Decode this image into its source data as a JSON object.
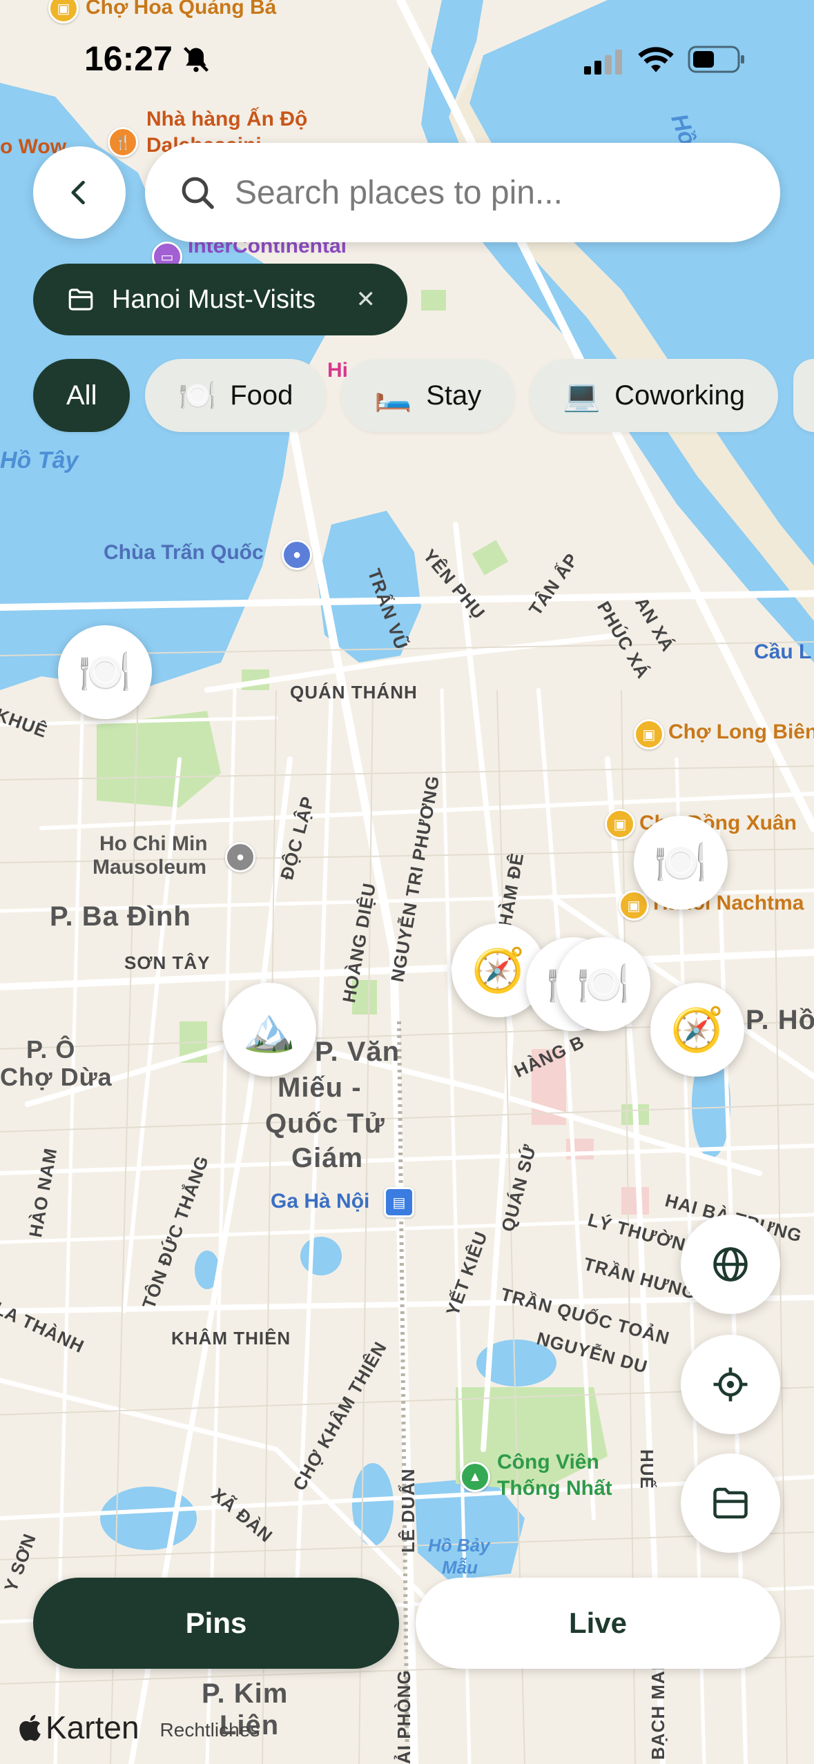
{
  "status_bar": {
    "time": "16:27",
    "icons": [
      "bell-slash-icon",
      "cellular-signal-icon",
      "wifi-icon",
      "battery-icon"
    ]
  },
  "header": {
    "back_icon": "chevron-left-icon",
    "search": {
      "placeholder": "Search places to pin...",
      "value": "",
      "icon": "search-icon"
    }
  },
  "collection": {
    "label": "Hanoi Must-Visits",
    "icon": "folder-icon",
    "close_icon": "close-icon"
  },
  "filters": [
    {
      "label": "All",
      "emoji": "",
      "active": true
    },
    {
      "label": "Food",
      "emoji": "🍽️",
      "active": false
    },
    {
      "label": "Stay",
      "emoji": "🛏️",
      "active": false
    },
    {
      "label": "Coworking",
      "emoji": "💻",
      "active": false
    }
  ],
  "map_labels": {
    "cho_hoa": "Chợ Hoa Quảng Bá",
    "nha_hang": "Nhà hàng Ấn Độ",
    "nha_hang2": "Dalchessini",
    "wow": "o Wow",
    "intercontinental": "InterContinental",
    "ho_tay": "Hồ Tây",
    "hi": "Hi",
    "hong": "Hồng",
    "chua_tran_quoc": "Chùa Trấn Quốc",
    "yen_phu": "YÊN PHỤ",
    "tan_ap": "TÂN ẤP",
    "tran_vu": "TRẤN VŨ",
    "phuc_xa": "PHÚC XÁ",
    "an_xa": "AN XÁ",
    "cau_l": "Cầu L",
    "khue": "KHUÊ",
    "quan_thanh": "QUÁN THÁNH",
    "cho_long_bien": "Chợ Long Biên",
    "cho_dong_xuan": "Chợ Đồng Xuân",
    "nachtma": "Hanoi Nachtma",
    "hcm_mausoleum_1": "Ho Chi Min",
    "hcm_mausoleum_2": "Mausoleum",
    "doc_lap": "ĐỘC LẬP",
    "nguyen_tri_phuong": "NGUYỄN TRI PHƯƠNG",
    "hoang_dieu": "HOÀNG DIỆU",
    "ham_de": "HÀM ĐÊ",
    "ba_dinh": "P. Ba Đình",
    "son_tay": "SƠN TÂY",
    "p_ho": "P. Hồ",
    "p_o_cho_dua_1": "P. Ô",
    "p_o_cho_dua_2": "Chợ Dừa",
    "van_mieu_1": "P. Văn",
    "van_mieu_2": "Miếu -",
    "van_mieu_3": "Quốc Tử",
    "van_mieu_4": "Giám",
    "hang_bong": "HÀNG B",
    "hao_nam": "HÀO NAM",
    "ton_duc_thang": "TÔN ĐỨC THẮNG",
    "ga_ha_noi": "Ga Hà Nội",
    "quan_su": "QUÁN SỨ",
    "hai_ba_trung": "HAI BÀ TRƯNG",
    "ly_thuong": "LÝ THƯỜNG",
    "la_thanh": "LA THÀNH",
    "yet_kieu": "YẾT KIÊU",
    "tran_hung_dao": "TRẦN HƯNG Đ",
    "tran_quoc_toan": "TRẦN QUỐC TOẢN",
    "nguyen_du": "NGUYỄN DU",
    "kham_thien": "KHÂM THIÊN",
    "cho_kham_thien": "CHỢ KHÂM THIÊN",
    "cong_vien_1": "Công Viên",
    "cong_vien_2": "Thống Nhất",
    "hue": "HUẾ",
    "xa_dan": "XÃ ĐÀN",
    "le_duan": "LÊ DUẨN",
    "ho_bay_mau_1": "Hồ Bảy",
    "ho_bay_mau_2": "Mẫu",
    "son": "Y SƠN",
    "p_kim_lien_1": "P. Kim",
    "p_kim_lien_2": "Liên",
    "ai_phong": "ẢI PHÒNG",
    "bach_mai": "BẠCH MAI"
  },
  "pins": [
    {
      "name": "food-pin",
      "emoji": "🍽️"
    },
    {
      "name": "food-pin",
      "emoji": "🍽️"
    },
    {
      "name": "compass-pin",
      "emoji": "🧭"
    },
    {
      "name": "food-pin",
      "emoji": "🍽️"
    },
    {
      "name": "food-pin",
      "emoji": "🍽️"
    },
    {
      "name": "compass-pin",
      "emoji": "🧭"
    },
    {
      "name": "mountain-pin",
      "emoji": "🏔️"
    }
  ],
  "fabs": [
    {
      "name": "globe-button",
      "icon": "globe-icon"
    },
    {
      "name": "locate-button",
      "icon": "crosshair-icon"
    },
    {
      "name": "folder-button",
      "icon": "folder-icon"
    }
  ],
  "tabs": {
    "pins": "Pins",
    "live": "Live"
  },
  "attribution": {
    "brand": "Karten",
    "legal": "Rechtliches"
  },
  "colors": {
    "dark_green": "#1e3a2e",
    "water": "#8fcdf2",
    "land": "#f4efe6",
    "park": "#c9e6b0"
  }
}
